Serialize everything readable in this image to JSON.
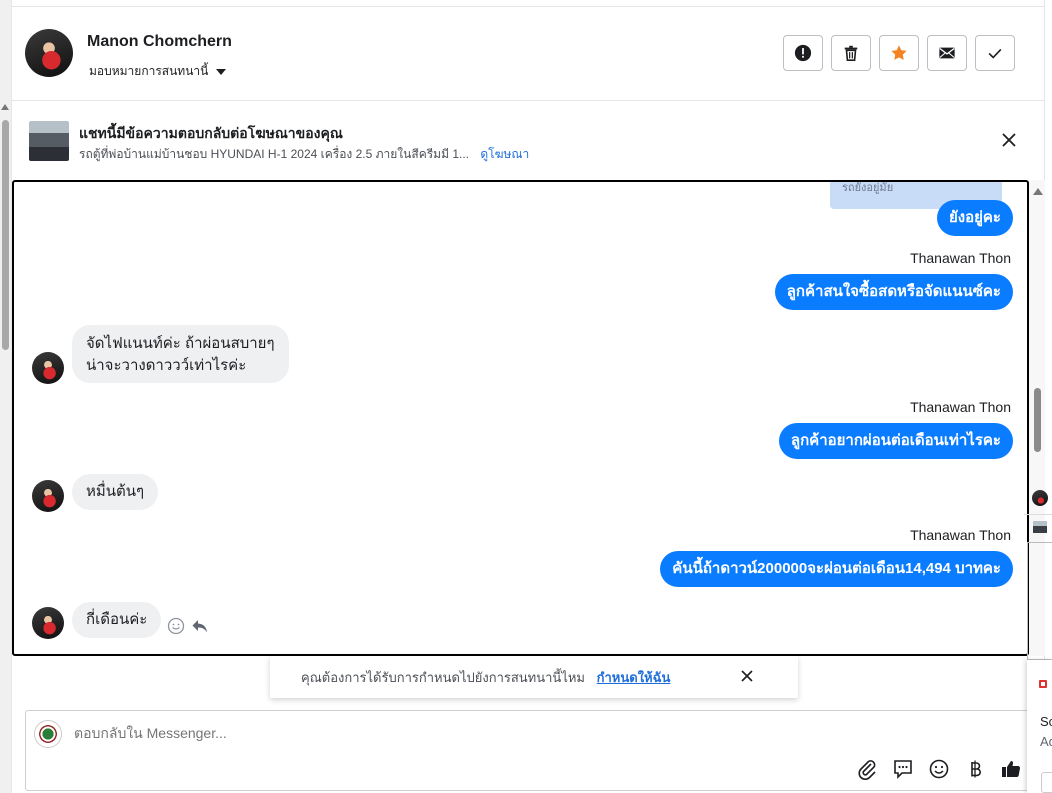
{
  "header": {
    "name": "Manon Chomchern",
    "assign_label": "มอบหมายการสนทนานี้"
  },
  "actions": {
    "spam_icon": "exclamation-icon",
    "delete_icon": "trash-icon",
    "star_icon": "star-icon",
    "unread_icon": "envelope-icon",
    "done_icon": "check-icon",
    "star_color": "#f5821f"
  },
  "ad": {
    "title": "แชทนี้มีข้อความตอบกลับต่อโฆษณาของคุณ",
    "subtitle": "รถตู้ที่พ่อบ้านแม่บ้านชอบ HYUNDAI H-1 2024 เครื่อง 2.5 ภายในสีครีมมี 1...",
    "link": "ดูโฆษณา"
  },
  "conversation": {
    "quoted_snippet": "รถยังอยู่มั้ย",
    "messages": [
      {
        "side": "out",
        "text": "ยังอยู่คะ"
      },
      {
        "side": "out",
        "sender": "Thanawan Thon",
        "text": "ลูกค้าสนใจซื้อสดหรือจัดแนนซ์คะ"
      },
      {
        "side": "in",
        "lines": [
          "จัดไฟแนนท์ค่ะ ถ้าผ่อนสบายๆ",
          "น่าจะวางดาววว์เท่าไรค่ะ"
        ]
      },
      {
        "side": "out",
        "sender": "Thanawan Thon",
        "text": "ลูกค้าอยากผ่อนต่อเดือนเท่าไรคะ"
      },
      {
        "side": "in",
        "text": "หมื่นต้นๆ"
      },
      {
        "side": "out",
        "sender": "Thanawan Thon",
        "text": "คันนี้ถ้าดาวน์200000จะผ่อนต่อเดือน14,494 บาทคะ"
      },
      {
        "side": "in",
        "text": "กี่เดือนค่ะ"
      }
    ],
    "outgoing_color": "#0a7cff",
    "incoming_color": "#eef0f2"
  },
  "toast": {
    "text": "คุณต้องการได้รับการกำหนดไปยังการสนทนานี้ไหม",
    "link": "กำหนดให้ฉัน"
  },
  "composer": {
    "placeholder": "ตอบกลับใน Messenger...",
    "tools": [
      "attach-icon",
      "saved-reply-icon",
      "emoji-icon",
      "baht-icon",
      "like-icon"
    ]
  },
  "side_peek": {
    "line1": "Sc",
    "line2": "Ad"
  }
}
